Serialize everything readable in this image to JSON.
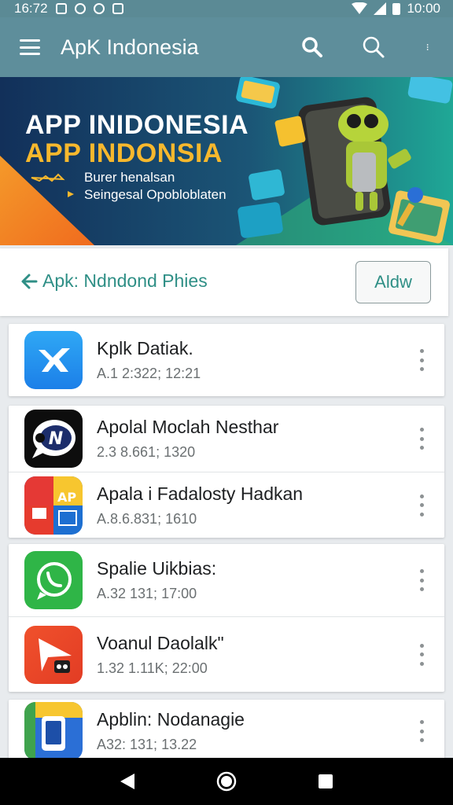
{
  "status_bar": {
    "time_left": "16:72",
    "time_right": "10:00"
  },
  "app_bar": {
    "title": "ApK Indonesia"
  },
  "banner": {
    "line1": "APP INIDONESIA",
    "line2": "APP INDONSIA",
    "sub1": "Burer henalsan",
    "sub2": "Seingesal Opobloblaten"
  },
  "header": {
    "back_label": "Apk: Ndndond Phies",
    "add_label": "Aldw"
  },
  "apps": [
    {
      "name": "Kplk Datiak.",
      "meta": "A.1 2:322; 12:21",
      "icon": "xender-icon"
    },
    {
      "name": "Apolal Moclah Nesthar",
      "meta": "2.3 8.661; 1320",
      "icon": "chat-bubble-icon"
    },
    {
      "name": "Apala i Fadalosty Hadkan",
      "meta": "A.8.6.831; 1610",
      "icon": "grid-apps-icon"
    },
    {
      "name": "Spalie Uikbias:",
      "meta": "A.32 131; 17:00",
      "icon": "whatsapp-icon"
    },
    {
      "name": "Voanul Daolalk\"",
      "meta": "1.32 1.11K; 22:00",
      "icon": "play-cut-icon"
    },
    {
      "name": "Apblin: Nodanagie",
      "meta": "A32: 131; 13.22",
      "icon": "phone-frame-icon"
    }
  ],
  "colors": {
    "appbar": "#5e8e9b",
    "accent": "#2f8f86",
    "banner_gold": "#f7b82d"
  }
}
